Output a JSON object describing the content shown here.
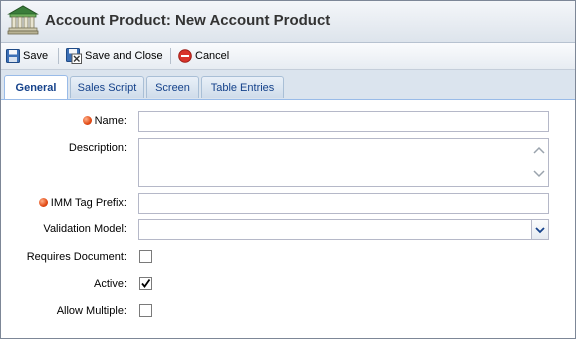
{
  "window": {
    "title": "Account Product: New Account Product"
  },
  "toolbar": {
    "save_label": "Save",
    "save_close_label": "Save and Close",
    "cancel_label": "Cancel"
  },
  "tabs": [
    {
      "label": "General",
      "active": true
    },
    {
      "label": "Sales Script",
      "active": false
    },
    {
      "label": "Screen",
      "active": false
    },
    {
      "label": "Table Entries",
      "active": false
    }
  ],
  "form": {
    "name_label": "Name:",
    "name_value": "",
    "description_label": "Description:",
    "description_value": "",
    "imm_label": "IMM Tag Prefix:",
    "imm_value": "",
    "validation_label": "Validation Model:",
    "validation_value": "",
    "requires_doc_label": "Requires Document:",
    "requires_doc_checked": false,
    "active_label": "Active:",
    "active_checked": true,
    "allow_multiple_label": "Allow Multiple:",
    "allow_multiple_checked": false
  },
  "colors": {
    "tab_text": "#15428b",
    "required_dot": "#e24a14",
    "cancel_icon": "#d9342b"
  },
  "icons": [
    "bank-icon",
    "save-icon",
    "save-close-icon",
    "cancel-icon",
    "checkmark-icon",
    "chevron-down-icon",
    "scroll-up-icon",
    "scroll-down-icon"
  ]
}
